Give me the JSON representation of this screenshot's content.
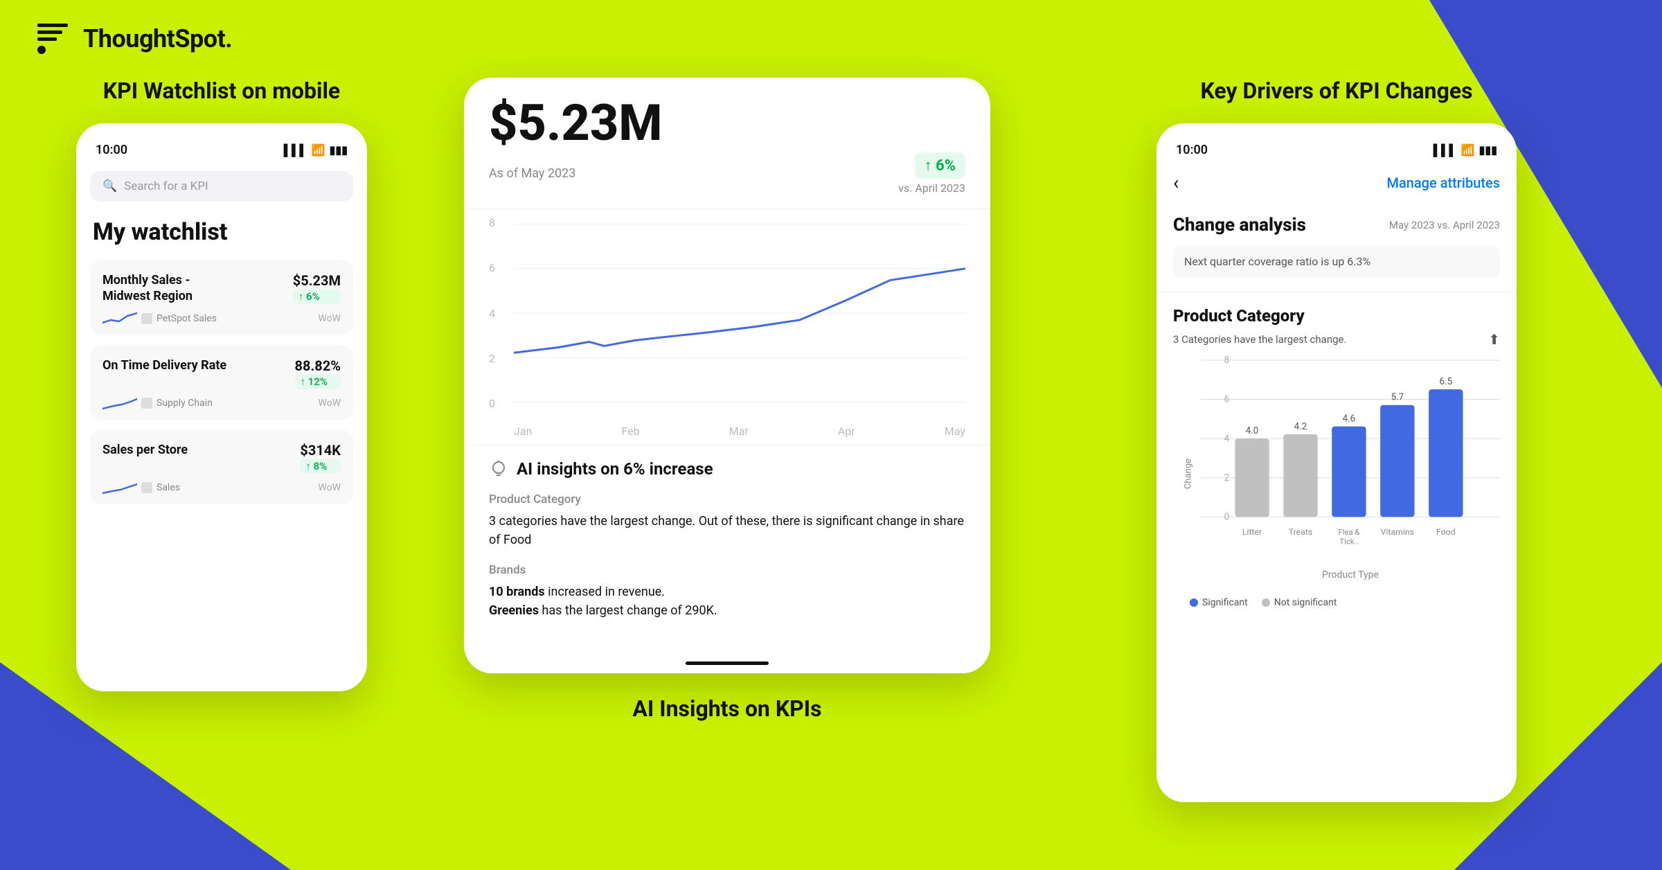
{
  "brand": {
    "logo_text": "ThoughtSpot.",
    "logo_icon": "T"
  },
  "left_panel": {
    "title": "KPI Watchlist on mobile",
    "phone": {
      "status_time": "10:00",
      "search_placeholder": "Search for a KPI",
      "watchlist_title": "My watchlist",
      "kpi_items": [
        {
          "name": "Monthly Sales -\nMidwest Region",
          "value": "$5.23M",
          "change": "↑ 6%",
          "source": "PetSpot Sales",
          "period": "WoW"
        },
        {
          "name": "On Time Delivery Rate",
          "value": "88.82%",
          "change": "↑ 12%",
          "source": "Supply Chain",
          "period": "WoW"
        },
        {
          "name": "Sales per Store",
          "value": "$314K",
          "change": "↑ 8%",
          "source": "Sales",
          "period": "WoW"
        }
      ]
    }
  },
  "center_panel": {
    "title": "AI Insights on KPIs",
    "phone": {
      "kpi_value": "$5.23M",
      "kpi_date": "As of May 2023",
      "kpi_change": "↑ 6%",
      "kpi_vs": "vs. April 2023",
      "chart": {
        "y_labels": [
          "8",
          "6",
          "4",
          "2",
          "0"
        ],
        "x_labels": [
          "Jan",
          "Feb",
          "Mar",
          "Apr",
          "May"
        ],
        "data_points": [
          {
            "x": 0,
            "y": 2.2
          },
          {
            "x": 1,
            "y": 2.8
          },
          {
            "x": 2,
            "y": 2.4
          },
          {
            "x": 3,
            "y": 3.0
          },
          {
            "x": 4,
            "y": 3.2
          },
          {
            "x": 5,
            "y": 3.4
          },
          {
            "x": 6,
            "y": 3.6
          },
          {
            "x": 7,
            "y": 4.0
          },
          {
            "x": 8,
            "y": 4.5
          },
          {
            "x": 9,
            "y": 5.5
          },
          {
            "x": 10,
            "y": 6.0
          }
        ]
      },
      "ai_insights_title": "AI insights on 6% increase",
      "insights": [
        {
          "category": "Product Category",
          "text": "3 categories have the largest change. Out of these, there is significant change in share of Food"
        },
        {
          "category": "Brands",
          "text": "10 brands increased in revenue. Greenies has the largest change of 290K.",
          "bold_words": [
            "10 brands",
            "Greenies"
          ]
        }
      ]
    }
  },
  "right_panel": {
    "title": "Key Drivers of KPI Changes",
    "phone": {
      "status_time": "10:00",
      "back_label": "‹",
      "manage_attributes": "Manage attributes",
      "change_analysis": {
        "title": "Change analysis",
        "dates": "May 2023  vs.  April 2023",
        "note": "Next quarter coverage ratio is up 6.3%"
      },
      "product_category": {
        "title": "Product Category",
        "subtitle": "3 Categories have the largest change.",
        "y_label": "Change",
        "x_label": "Product Type",
        "bars": [
          {
            "label": "Litter",
            "value": 4.0,
            "color": "#c0c0c0"
          },
          {
            "label": "Treats",
            "value": 4.2,
            "color": "#c0c0c0"
          },
          {
            "label": "Flea &\nTick..",
            "value": 4.6,
            "color": "#4169e1"
          },
          {
            "label": "Vitamins",
            "value": 5.7,
            "color": "#4169e1"
          },
          {
            "label": "Food",
            "value": 6.5,
            "color": "#4169e1"
          }
        ],
        "y_max": 8,
        "y_ticks": [
          0,
          2,
          4,
          6,
          8
        ]
      },
      "legend": [
        {
          "label": "Significant",
          "color": "#4169e1"
        },
        {
          "label": "Not significant",
          "color": "#c0c0c0"
        }
      ]
    }
  }
}
